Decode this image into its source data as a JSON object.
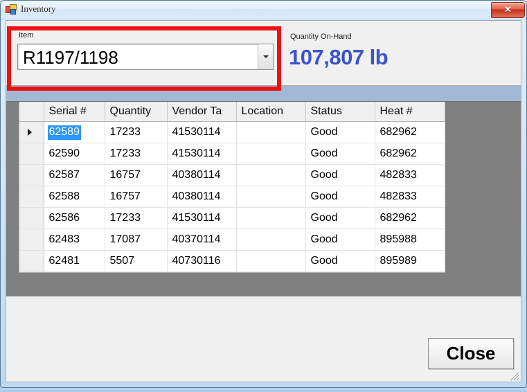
{
  "window": {
    "title": "Inventory",
    "icon": "form-icon",
    "close_glyph": "✕",
    "close_tooltip": "Close"
  },
  "form": {
    "item_label": "Item",
    "item_value": "R1197/1198",
    "item_dropdown_icon": "chevron-down-icon",
    "quantity_label": "Quantity On-Hand",
    "quantity_value": "107,807 lb",
    "quantity_color": "#3a53cc"
  },
  "grid": {
    "columns": [
      "Serial #",
      "Quantity",
      "Vendor Ta",
      "Location",
      "Status",
      "Heat #"
    ],
    "selected_cell": {
      "row": 0,
      "column": 0,
      "value": "62589",
      "highlight_color": "#2e96f5"
    },
    "current_row_indicator": "▶",
    "rows": [
      {
        "serial": "62589",
        "quantity": "17233",
        "vendor_tag": "41530114",
        "location": "",
        "status": "Good",
        "heat": "682962"
      },
      {
        "serial": "62590",
        "quantity": "17233",
        "vendor_tag": "41530114",
        "location": "",
        "status": "Good",
        "heat": "682962"
      },
      {
        "serial": "62587",
        "quantity": "16757",
        "vendor_tag": "40380114",
        "location": "",
        "status": "Good",
        "heat": "482833"
      },
      {
        "serial": "62588",
        "quantity": "16757",
        "vendor_tag": "40380114",
        "location": "",
        "status": "Good",
        "heat": "482833"
      },
      {
        "serial": "62586",
        "quantity": "17233",
        "vendor_tag": "41530114",
        "location": "",
        "status": "Good",
        "heat": "682962"
      },
      {
        "serial": "62483",
        "quantity": "17087",
        "vendor_tag": "40370114",
        "location": "",
        "status": "Good",
        "heat": "895988"
      },
      {
        "serial": "62481",
        "quantity": "5507",
        "vendor_tag": "40730116",
        "location": "",
        "status": "Good",
        "heat": "895989"
      }
    ]
  },
  "footer": {
    "close_label": "Close"
  },
  "annotation": {
    "color": "#ee1111",
    "target": "item-selector"
  }
}
